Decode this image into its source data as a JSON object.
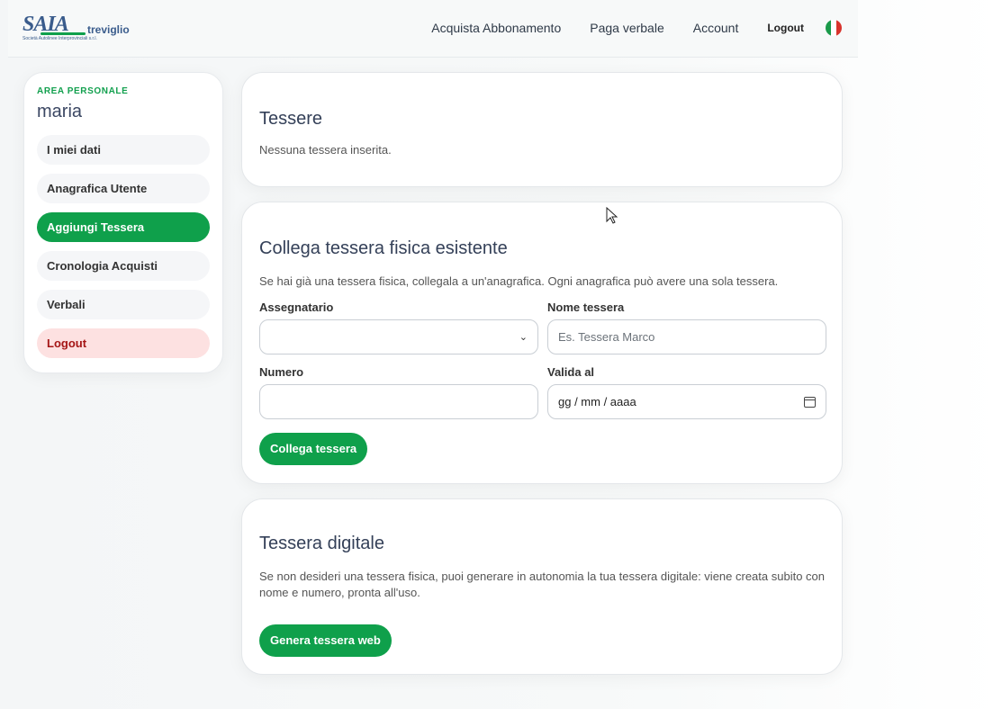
{
  "header": {
    "logo": {
      "brand": "SAIA",
      "city": "treviglio",
      "tagline": "Società Autolinee Interprovinciali s.r.l."
    },
    "nav": [
      "Acquista Abbonamento",
      "Paga verbale",
      "Account"
    ],
    "logout": "Logout",
    "language_flag": "italy-flag-icon"
  },
  "sidebar": {
    "area_label": "AREA PERSONALE",
    "username": "maria",
    "items": [
      {
        "label": "I miei dati"
      },
      {
        "label": "Anagrafica Utente"
      },
      {
        "label": "Aggiungi Tessera",
        "active": true
      },
      {
        "label": "Cronologia Acquisti"
      },
      {
        "label": "Verbali"
      },
      {
        "label": "Logout"
      }
    ]
  },
  "tessere": {
    "title": "Tessere",
    "empty_text": "Nessuna tessera inserita."
  },
  "collega": {
    "title": "Collega tessera fisica esistente",
    "description": "Se hai già una tessera fisica, collegala a un'anagrafica. Ogni anagrafica può avere una sola tessera.",
    "assegnatario_label": "Assegnatario",
    "assegnatario_value": "",
    "nome_label": "Nome tessera",
    "nome_placeholder": "Es. Tessera Marco",
    "numero_label": "Numero",
    "numero_value": "",
    "valida_label": "Valida al",
    "valida_placeholder": "gg / mm / aaaa",
    "button": "Collega tessera"
  },
  "digitale": {
    "title": "Tessera digitale",
    "description": "Se non desideri una tessera fisica, puoi generare in autonomia la tua tessera digitale: viene creata subito con nome e numero, pronta all'uso.",
    "button": "Genera tessera web"
  },
  "colors": {
    "accent": "#0fa04b",
    "heading": "#344058",
    "logout_bg": "#fde1e1",
    "logout_text": "#a51616"
  }
}
